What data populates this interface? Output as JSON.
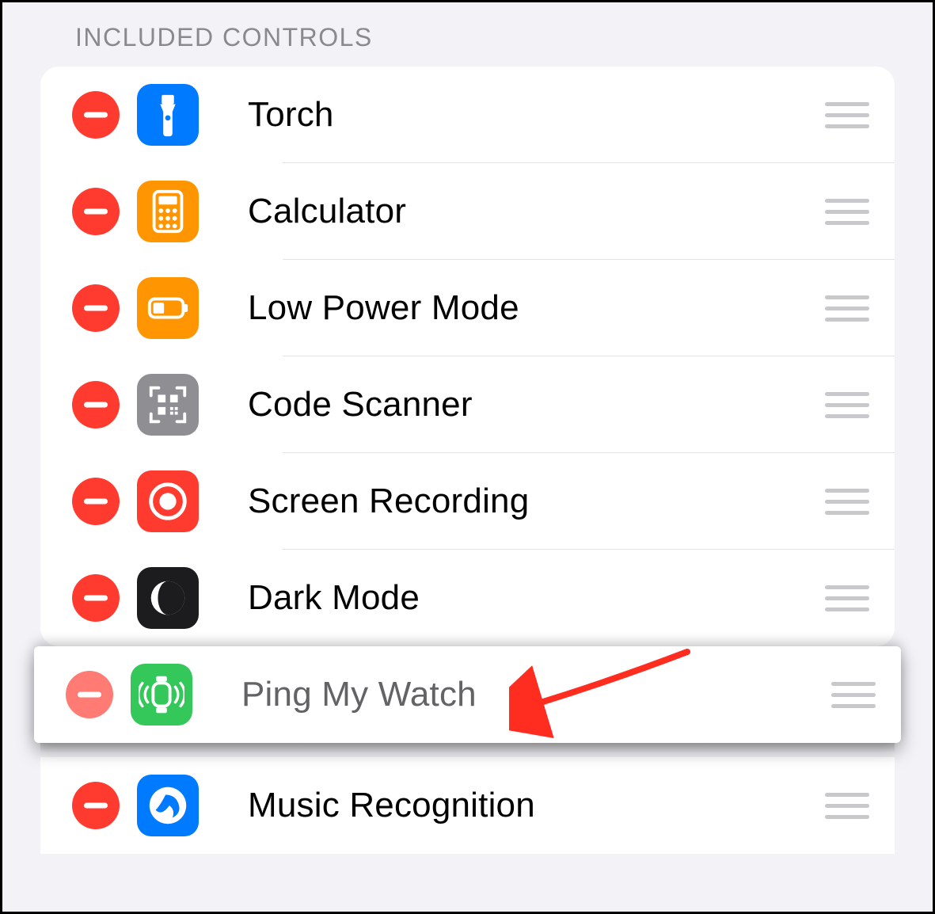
{
  "section_header": "INCLUDED CONTROLS",
  "controls": [
    {
      "id": "torch",
      "label": "Torch",
      "icon": "torch-icon",
      "icon_bg": "bg-blue"
    },
    {
      "id": "calculator",
      "label": "Calculator",
      "icon": "calculator-icon",
      "icon_bg": "bg-orange"
    },
    {
      "id": "low-power-mode",
      "label": "Low Power Mode",
      "icon": "low-power-mode-icon",
      "icon_bg": "bg-orange"
    },
    {
      "id": "code-scanner",
      "label": "Code Scanner",
      "icon": "code-scanner-icon",
      "icon_bg": "bg-gray"
    },
    {
      "id": "screen-recording",
      "label": "Screen Recording",
      "icon": "screen-recording-icon",
      "icon_bg": "bg-red"
    },
    {
      "id": "dark-mode",
      "label": "Dark Mode",
      "icon": "dark-mode-icon",
      "icon_bg": "bg-black"
    },
    {
      "id": "ping-my-watch",
      "label": "Ping My Watch",
      "icon": "ping-my-watch-icon",
      "icon_bg": "bg-green",
      "dragging": true
    },
    {
      "id": "music-recognition",
      "label": "Music Recognition",
      "icon": "music-recognition-icon",
      "icon_bg": "bg-blue"
    }
  ],
  "annotation": {
    "points_to": "ping-my-watch",
    "color": "#ff2d1f"
  }
}
